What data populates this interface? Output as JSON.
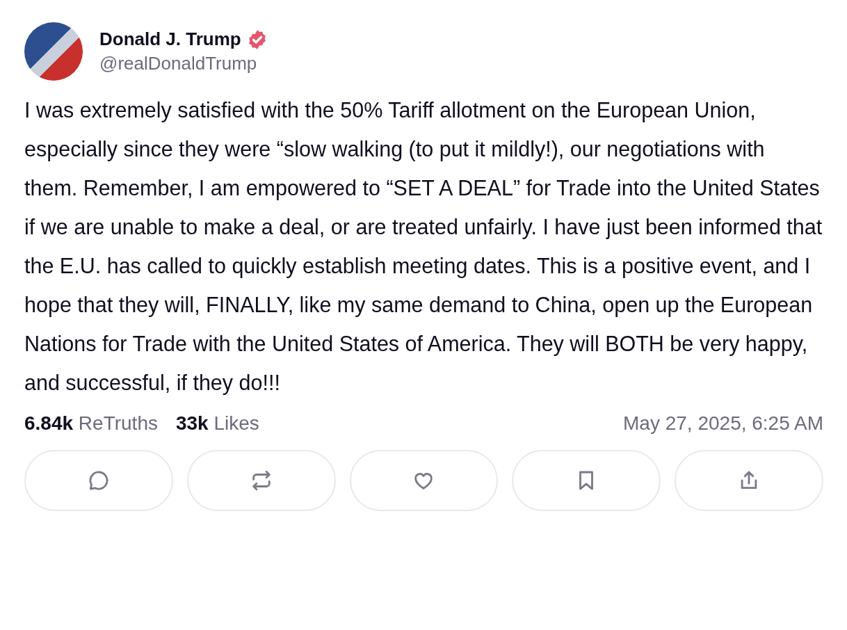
{
  "author": {
    "name": "Donald J. Trump",
    "verified": true,
    "handle": "@realDonaldTrump"
  },
  "post": {
    "text": "I was extremely satisfied with the 50% Tariff allotment on the European Union, especially since they were “slow walking (to put it mildly!), our negotiations with them. Remember, I am empowered to “SET A DEAL” for Trade into the United States if we are unable to make a deal, or are treated unfairly. I have just been informed that the E.U. has called to quickly establish meeting dates. This is a positive event, and I hope that they will, FINALLY, like my same demand to China, open up the European Nations for Trade with the United States of America. They will BOTH be very happy, and successful, if they do!!!"
  },
  "stats": [
    {
      "count": "6.84k",
      "label": "ReTruths"
    },
    {
      "count": "33k",
      "label": "Likes"
    }
  ],
  "timestamp": "May 27, 2025, 6:25 AM"
}
